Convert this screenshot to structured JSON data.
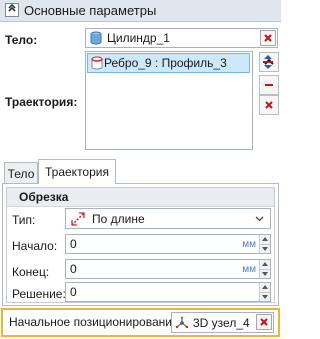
{
  "header": {
    "title": "Основные параметры",
    "toggle_icon": "chevron-up-icon"
  },
  "body_field": {
    "label": "Тело:",
    "value": "Цилиндр_1",
    "icon": "cylinder-icon"
  },
  "trajectory_field": {
    "label": "Траектория:",
    "items": [
      {
        "label": "Ребро_9 : Профиль_3",
        "icon": "edge-cylinder-icon"
      }
    ]
  },
  "tabs": [
    {
      "label": "Тело",
      "active": false
    },
    {
      "label": "Траектория",
      "active": true
    }
  ],
  "trim": {
    "title": "Обрезка",
    "type": {
      "label": "Тип:",
      "value": "По длине",
      "icon": "length-icon"
    },
    "start": {
      "label": "Начало:",
      "value": "0",
      "unit": "мм"
    },
    "end": {
      "label": "Конец:",
      "value": "0",
      "unit": "мм"
    },
    "solution": {
      "label": "Решение:",
      "value": "0"
    }
  },
  "positioning": {
    "label": "Начальное позиционирование:",
    "value": "3D узел_4",
    "icon": "3d-node-icon"
  },
  "colors": {
    "highlight": "#f0b43b",
    "selection": "#cde8fb",
    "delete": "#c0141b",
    "unit": "#4a7fc2"
  }
}
